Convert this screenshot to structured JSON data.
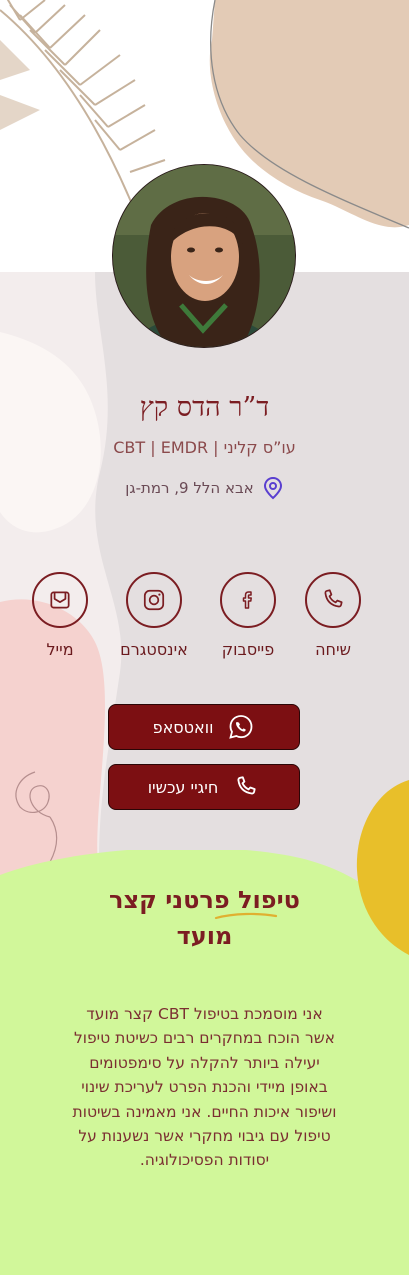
{
  "profile": {
    "name": "ד”ר הדס קץ",
    "subtitle": "עו”ס קליני | CBT | EMDR",
    "address": "אבא הלל 9, רמת-גן"
  },
  "actions": [
    {
      "label": "שיחה",
      "icon": "phone-icon"
    },
    {
      "label": "פייסבוק",
      "icon": "facebook-icon"
    },
    {
      "label": "אינסטגרם",
      "icon": "instagram-icon"
    },
    {
      "label": "מייל",
      "icon": "mail-icon"
    }
  ],
  "buttons": {
    "whatsapp": "וואטסאפ",
    "call_now": "חיגיי עכשיו"
  },
  "section": {
    "title_line1": "טיפול פרטני קצר",
    "title_line2": "מועד",
    "body": "אני מוסמכת בטיפול CBT קצר מועד אשר הוכח במחקרים רבים כשיטת טיפול יעילה ביותר להקלה על סימפטומים באופן מיידי והכנת הפרט לעריכת שינוי ושיפור איכות החיים. אני מאמינה בשיטות טיפול עם גיבוי מחקרי אשר נשענות על יסודות הפסיכולוגיה."
  },
  "colors": {
    "brand": "#7b1d22",
    "button": "#7c0f12",
    "green_section": "#d1f79a",
    "accent_yellow": "#e8bf2a",
    "pin": "#5a3fd0"
  }
}
